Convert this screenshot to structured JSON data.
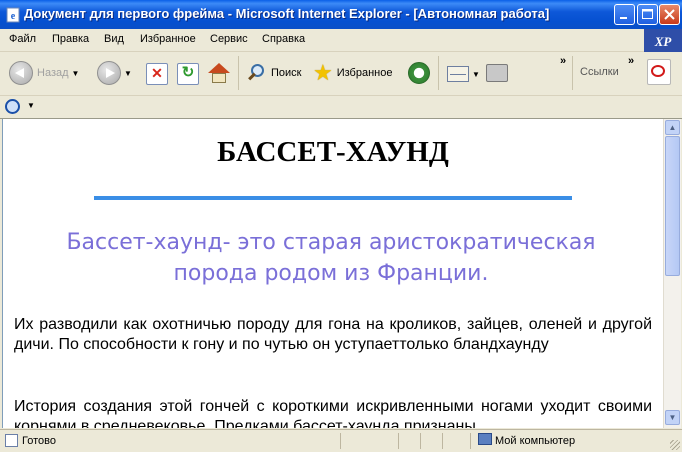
{
  "window": {
    "title": "Документ для первого фрейма - Microsoft Internet Explorer - [Автономная работа]"
  },
  "menu": [
    "Файл",
    "Правка",
    "Вид",
    "Избранное",
    "Сервис",
    "Справка"
  ],
  "toolbar": {
    "back_label": "Назад",
    "search_label": "Поиск",
    "favorites_label": "Избранное",
    "links_label": "Ссылки",
    "chevron": "»"
  },
  "content": {
    "title": "БАССЕТ-ХАУНД",
    "lead": "Бассет-хаунд- это старая аристократическая порода родом из Франции.",
    "paragraph1": "Их разводили как охотничью породу для гона на кроликов, зайцев, оленей и другой дичи. По способности к гону и по чутью он уступаеттолько бландхаунду",
    "paragraph2": "История создания этой гончей с короткими искривленными ногами уходит своими корнями в средневековье. Предками бассет-хаунда признаны"
  },
  "status": {
    "text": "Готово",
    "zone": "Мой компьютер"
  },
  "colors": {
    "lead_text": "#7A6FD8",
    "rule": "#3A8EE6",
    "titlebar": "#0A5FE8"
  }
}
